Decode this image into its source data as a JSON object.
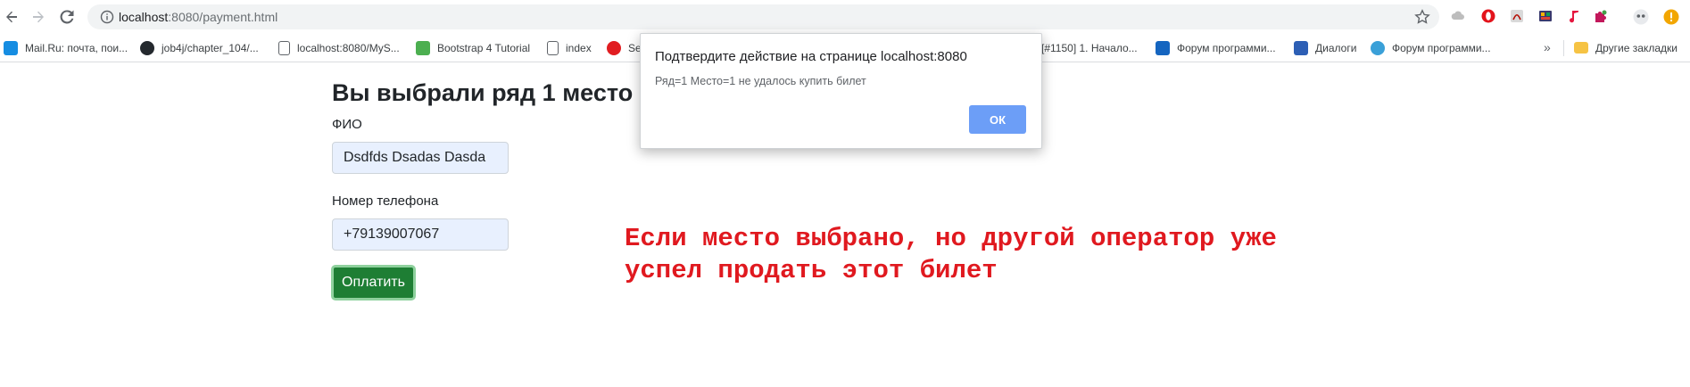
{
  "browser": {
    "url_host": "localhost",
    "url_path": ":8080/payment.html",
    "icons": [
      "back-icon",
      "forward-icon",
      "reload-icon",
      "info-icon",
      "star-icon"
    ]
  },
  "bookmarks": [
    {
      "label": "Mail.Ru: почта, пои...",
      "icon": "mailru-icon",
      "color": "#168de2"
    },
    {
      "label": "job4j/chapter_104/...",
      "icon": "github-icon",
      "color": "#24292e"
    },
    {
      "label": "localhost:8080/MyS...",
      "icon": "page-icon",
      "color": "#5f6368"
    },
    {
      "label": "Bootstrap 4 Tutorial",
      "icon": "w3schools-icon",
      "color": "#4caf50"
    },
    {
      "label": "index",
      "icon": "page-icon",
      "color": "#5f6368"
    },
    {
      "label": "Se",
      "icon": "java-icon",
      "color": "#e11d21"
    },
    {
      "label": "[#1150] 1. Начало...",
      "icon": "tracker-icon",
      "color": "#5f6368"
    },
    {
      "label": "Форум программи...",
      "icon": "forum-icon",
      "color": "#1565c0"
    },
    {
      "label": "Диалоги",
      "icon": "chat-icon",
      "color": "#2d5fb5"
    },
    {
      "label": "Форум программи...",
      "icon": "forum-icon",
      "color": "#3aa0d8"
    }
  ],
  "bookmarks_more": "»",
  "other_bookmarks": "Другие закладки",
  "page": {
    "heading": "Вы выбрали ряд 1 место 1,",
    "fio_label": "ФИО",
    "fio_value": "Dsdfds Dsadas Dasda",
    "phone_label": "Номер телефона",
    "phone_value": "+79139007067",
    "pay_button": "Оплатить",
    "note_line1": "Если место выбрано, но другой оператор уже",
    "note_line2": "успел продать этот билет"
  },
  "dialog": {
    "title": "Подтвердите действие на странице localhost:8080",
    "message": "Ряд=1 Место=1 не удалось купить билет",
    "ok_label": "ОК"
  },
  "colors": {
    "pay_button": "#1e7e34",
    "note": "#e0191f",
    "ok_button": "#6c9ef7",
    "input_bg": "#e8f0fe"
  }
}
